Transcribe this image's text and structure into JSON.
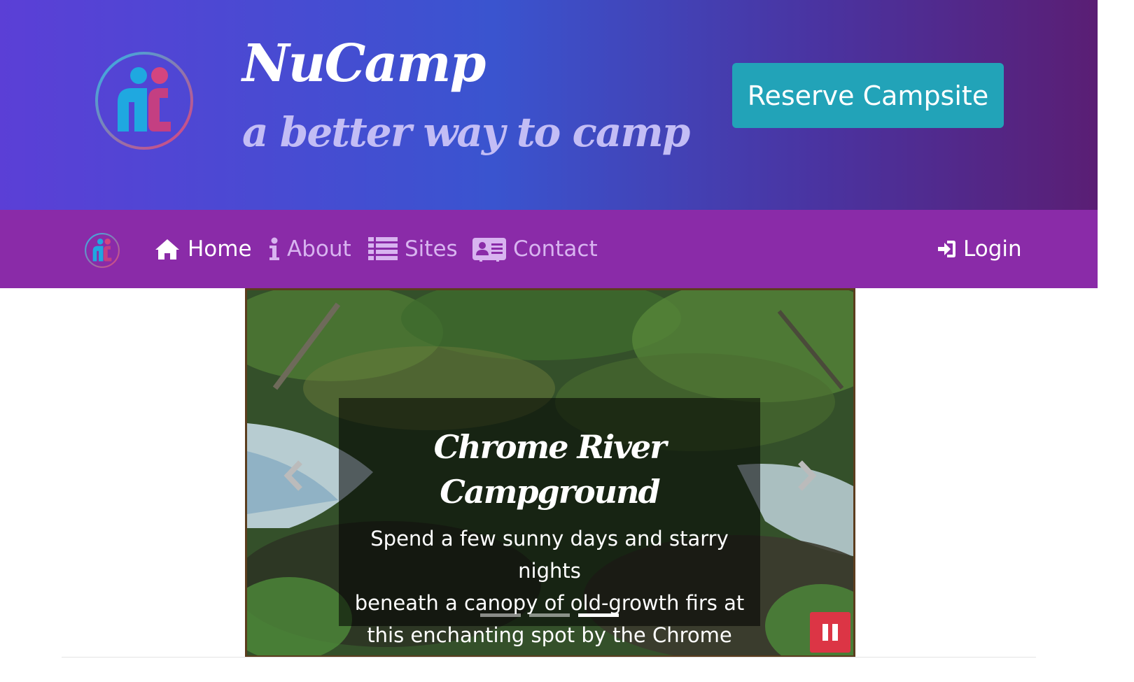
{
  "header": {
    "title": "NuCamp",
    "tagline": "a better way to camp",
    "reserve_label": "Reserve Campsite",
    "logo_icon": "nucamp-logo-icon"
  },
  "nav": {
    "items": [
      {
        "label": "Home",
        "icon": "home-icon",
        "active": true
      },
      {
        "label": "About",
        "icon": "info-icon",
        "active": false
      },
      {
        "label": "Sites",
        "icon": "list-icon",
        "active": false
      },
      {
        "label": "Contact",
        "icon": "address-card-icon",
        "active": false
      }
    ],
    "login_label": "Login",
    "login_icon": "sign-in-icon"
  },
  "carousel": {
    "caption_title": "Chrome River Campground",
    "caption_text_lines": [
      "Spend a few sunny days and starry nights",
      "beneath a canopy of old-growth firs at",
      "this enchanting spot by the Chrome River"
    ],
    "slide_count": 3,
    "active_slide": 3,
    "pause_icon": "pause-icon"
  },
  "colors": {
    "header_gradient_start": "#5b3fd6",
    "header_gradient_end": "#5a1e74",
    "navbar": "#8a2ba8",
    "reserve_button": "#22a3b8",
    "pause_button": "#dc3545",
    "carousel_border": "#5c3d1e"
  }
}
